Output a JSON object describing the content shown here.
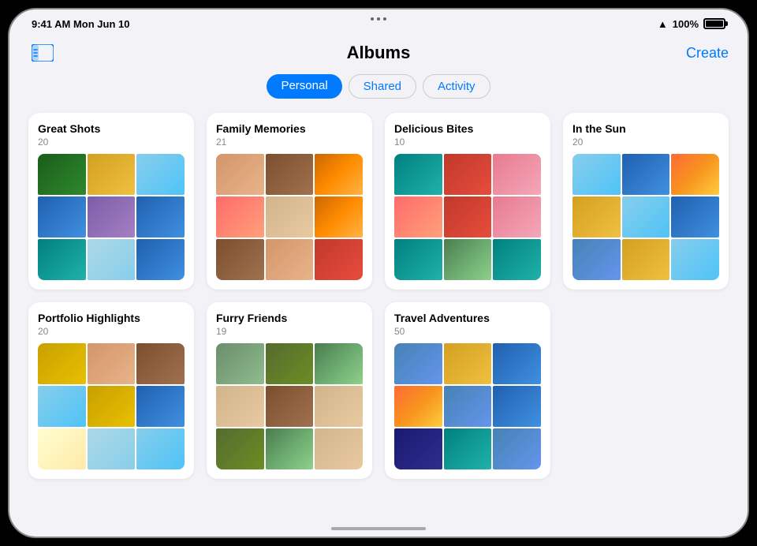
{
  "statusBar": {
    "time": "9:41 AM  Mon Jun 10",
    "wifi": "📶",
    "battery_pct": "100%"
  },
  "header": {
    "title": "Albums",
    "create_label": "Create"
  },
  "tabs": [
    {
      "id": "personal",
      "label": "Personal",
      "active": true
    },
    {
      "id": "shared",
      "label": "Shared",
      "active": false
    },
    {
      "id": "activity",
      "label": "Activity",
      "active": false
    }
  ],
  "albums": [
    {
      "id": "great-shots",
      "title": "Great Shots",
      "count": "20",
      "photos": [
        "photo-darkgreen",
        "photo-yellow",
        "photo-sky",
        "photo-blue",
        "photo-purple",
        "photo-blue",
        "photo-teal",
        "photo-lightblue",
        "photo-blue"
      ]
    },
    {
      "id": "family-memories",
      "title": "Family Memories",
      "count": "21",
      "photos": [
        "photo-warm",
        "photo-brown",
        "photo-orange",
        "photo-coral",
        "photo-tan",
        "photo-orange",
        "photo-brown",
        "photo-warm",
        "photo-red"
      ]
    },
    {
      "id": "delicious-bites",
      "title": "Delicious Bites",
      "count": "10",
      "photos": [
        "photo-teal",
        "photo-red",
        "photo-pink",
        "photo-coral",
        "photo-red",
        "photo-pink",
        "photo-teal",
        "photo-green",
        "photo-teal"
      ]
    },
    {
      "id": "in-the-sun",
      "title": "In the Sun",
      "count": "20",
      "photos": [
        "photo-sky",
        "photo-blue",
        "photo-sunset",
        "photo-yellow",
        "photo-sky",
        "photo-blue",
        "photo-steel",
        "photo-yellow",
        "photo-sky"
      ]
    },
    {
      "id": "portfolio-highlights",
      "title": "Portfolio Highlights",
      "count": "20",
      "photos": [
        "photo-golden",
        "photo-warm",
        "photo-brown",
        "photo-sky",
        "photo-golden",
        "photo-blue",
        "photo-cream",
        "photo-lightblue",
        "photo-sky"
      ]
    },
    {
      "id": "furry-friends",
      "title": "Furry Friends",
      "count": "19",
      "photos": [
        "photo-sage",
        "photo-olive",
        "photo-green",
        "photo-tan",
        "photo-brown",
        "photo-tan",
        "photo-olive",
        "photo-green",
        "photo-tan"
      ]
    },
    {
      "id": "travel-adventures",
      "title": "Travel Adventures",
      "count": "50",
      "photos": [
        "photo-steel",
        "photo-yellow",
        "photo-blue",
        "photo-sunset",
        "photo-steel",
        "photo-blue",
        "photo-midnight",
        "photo-teal",
        "photo-steel"
      ]
    }
  ]
}
